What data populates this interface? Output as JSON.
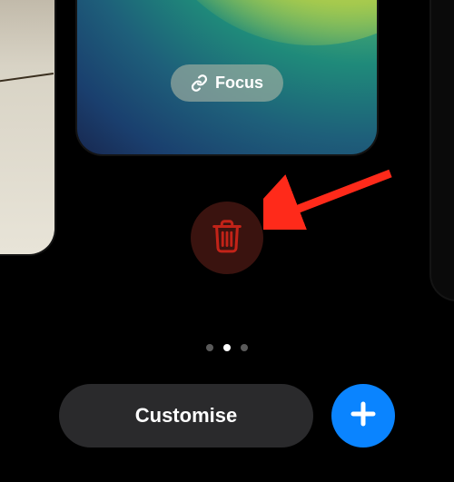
{
  "focus": {
    "label": "Focus"
  },
  "buttons": {
    "customise": "Customise"
  },
  "pager": {
    "count": 3,
    "active_index": 1
  },
  "colors": {
    "accent": "#0a84ff",
    "delete_bg": "#3a130f",
    "delete_icon": "#c22318",
    "arrow": "#ff2a1a"
  }
}
